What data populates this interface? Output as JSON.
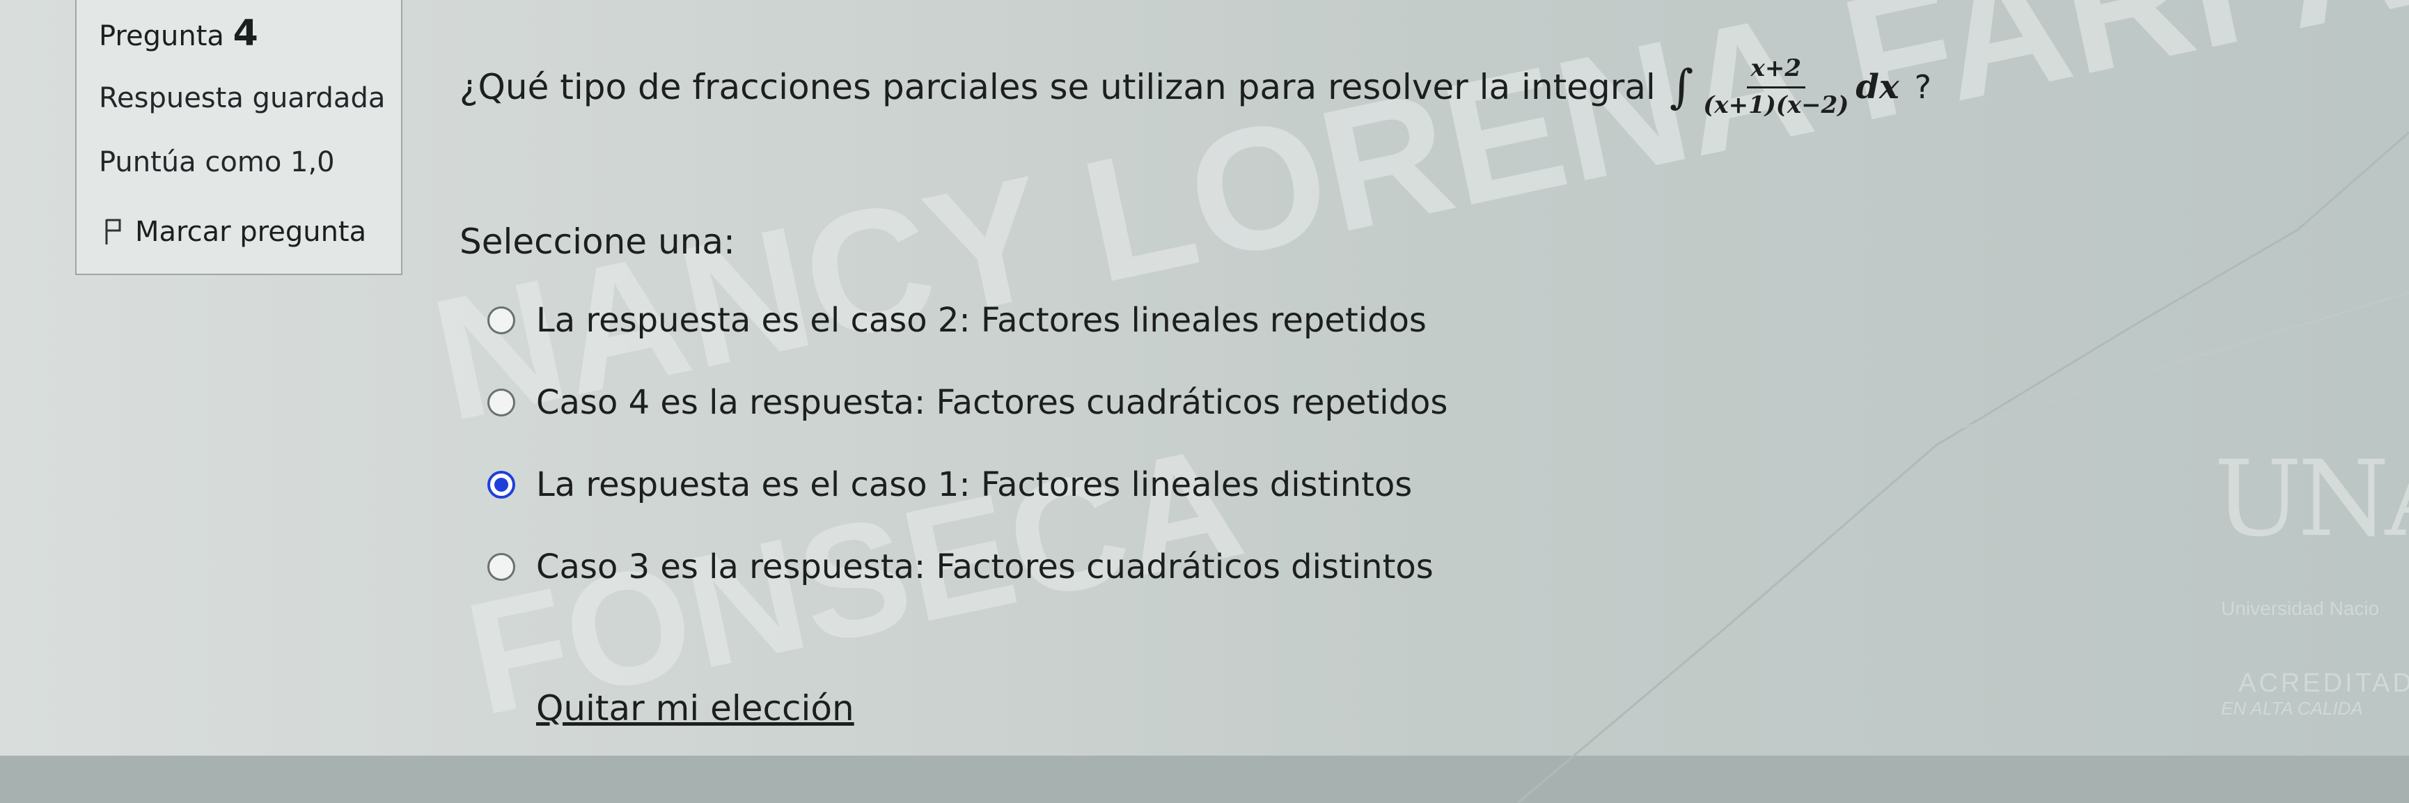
{
  "sidebar": {
    "question_label": "Pregunta",
    "question_number": "4",
    "status": "Respuesta guardada",
    "score": "Puntúa como 1,0",
    "flag_label": "Marcar pregunta"
  },
  "question": {
    "text": "¿Qué tipo de fracciones parciales se utilizan para resolver la integral",
    "integral_sign": "∫",
    "numerator": "x+2",
    "denominator": "(x+1)(x−2)",
    "differential": "dx",
    "question_mark": "?"
  },
  "select_label": "Seleccione una:",
  "options": [
    {
      "label": "La respuesta es el caso 2: Factores lineales repetidos",
      "checked": false
    },
    {
      "label": "Caso 4 es la respuesta: Factores cuadráticos repetidos",
      "checked": false
    },
    {
      "label": "La respuesta es el caso 1: Factores lineales distintos",
      "checked": true
    },
    {
      "label": "Caso 3 es la respuesta: Factores cuadráticos distintos",
      "checked": false
    }
  ],
  "clear_choice": "Quitar mi elección",
  "watermark": {
    "line1": "NANCY LORENA FARFAN",
    "line2": "FONSECA"
  },
  "logo": {
    "letters": "UNA",
    "university": "Universidad Nacio",
    "accredited": "ACREDITADA",
    "quality": "EN ALTA CALIDA"
  },
  "colors": {
    "accent": "#1e40d8",
    "text": "#1c1f1e"
  }
}
